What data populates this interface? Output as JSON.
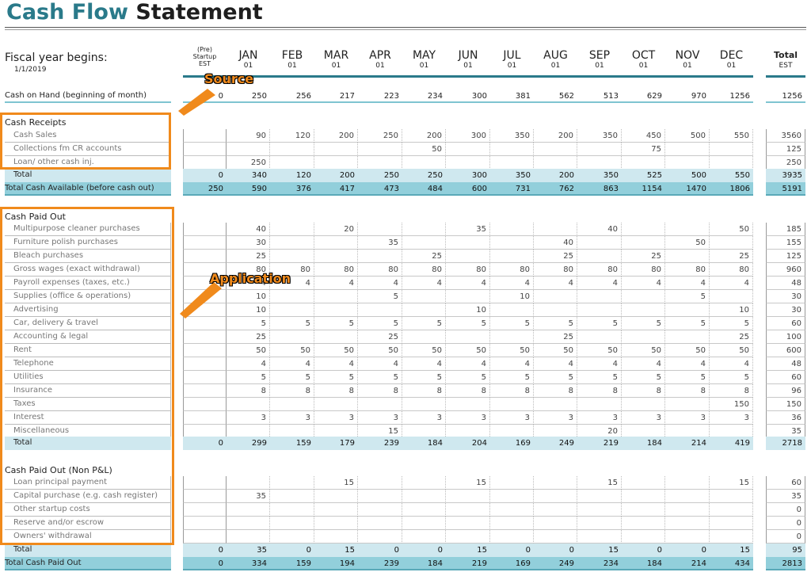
{
  "title": {
    "part1": "Cash Flow",
    "part2": "Statement"
  },
  "fiscal_label": "Fiscal year begins:",
  "fiscal_date": "1/1/2019",
  "columns": [
    {
      "pre": [
        "(Pre)",
        "Startup",
        "EST"
      ]
    },
    {
      "m": "JAN",
      "d": "01"
    },
    {
      "m": "FEB",
      "d": "01"
    },
    {
      "m": "MAR",
      "d": "01"
    },
    {
      "m": "APR",
      "d": "01"
    },
    {
      "m": "MAY",
      "d": "01"
    },
    {
      "m": "JUN",
      "d": "01"
    },
    {
      "m": "JUL",
      "d": "01"
    },
    {
      "m": "AUG",
      "d": "01"
    },
    {
      "m": "SEP",
      "d": "01"
    },
    {
      "m": "OCT",
      "d": "01"
    },
    {
      "m": "NOV",
      "d": "01"
    },
    {
      "m": "DEC",
      "d": "01"
    },
    {
      "m": "Total",
      "d": "EST"
    }
  ],
  "cash_on_hand": {
    "label": "Cash on Hand (beginning of month)",
    "values": [
      "0",
      "250",
      "256",
      "217",
      "223",
      "234",
      "300",
      "381",
      "562",
      "513",
      "629",
      "970",
      "1256",
      "1256"
    ]
  },
  "cash_receipts": {
    "header": "Cash Receipts",
    "rows": [
      {
        "label": "Cash Sales",
        "values": [
          "",
          "90",
          "120",
          "200",
          "250",
          "200",
          "300",
          "350",
          "200",
          "350",
          "450",
          "500",
          "550",
          "3560"
        ]
      },
      {
        "label": "Collections fm CR accounts",
        "values": [
          "",
          "",
          "",
          "",
          "",
          "50",
          "",
          "",
          "",
          "",
          "75",
          "",
          "",
          "125"
        ]
      },
      {
        "label": "Loan/ other cash inj.",
        "values": [
          "",
          "250",
          "",
          "",
          "",
          "",
          "",
          "",
          "",
          "",
          "",
          "",
          "",
          "250"
        ]
      }
    ],
    "total": {
      "label": "Total",
      "values": [
        "0",
        "340",
        "120",
        "200",
        "250",
        "250",
        "300",
        "350",
        "200",
        "350",
        "525",
        "500",
        "550",
        "3935"
      ]
    },
    "available": {
      "label": "Total Cash Available (before cash out)",
      "values": [
        "250",
        "590",
        "376",
        "417",
        "473",
        "484",
        "600",
        "731",
        "762",
        "863",
        "1154",
        "1470",
        "1806",
        "5191"
      ]
    }
  },
  "cash_paid_out": {
    "header": "Cash Paid Out",
    "rows": [
      {
        "label": "Multipurpose cleaner purchases",
        "values": [
          "",
          "40",
          "",
          "20",
          "",
          "",
          "35",
          "",
          "",
          "40",
          "",
          "",
          "50",
          "185"
        ]
      },
      {
        "label": "Furniture polish purchases",
        "values": [
          "",
          "30",
          "",
          "",
          "35",
          "",
          "",
          "",
          "40",
          "",
          "",
          "50",
          "",
          "155"
        ]
      },
      {
        "label": "Bleach purchases",
        "values": [
          "",
          "25",
          "",
          "",
          "",
          "25",
          "",
          "",
          "25",
          "",
          "25",
          "",
          "25",
          "125"
        ]
      },
      {
        "label": "Gross wages (exact withdrawal)",
        "values": [
          "",
          "80",
          "80",
          "80",
          "80",
          "80",
          "80",
          "80",
          "80",
          "80",
          "80",
          "80",
          "80",
          "960"
        ]
      },
      {
        "label": "Payroll expenses (taxes, etc.)",
        "values": [
          "",
          "4",
          "4",
          "4",
          "4",
          "4",
          "4",
          "4",
          "4",
          "4",
          "4",
          "4",
          "4",
          "48"
        ]
      },
      {
        "label": "Supplies (office & operations)",
        "values": [
          "",
          "10",
          "",
          "",
          "5",
          "",
          "",
          "10",
          "",
          "",
          "",
          "5",
          "",
          "30"
        ]
      },
      {
        "label": "Advertising",
        "values": [
          "",
          "10",
          "",
          "",
          "",
          "",
          "10",
          "",
          "",
          "",
          "",
          "",
          "10",
          "30"
        ]
      },
      {
        "label": "Car, delivery & travel",
        "values": [
          "",
          "5",
          "5",
          "5",
          "5",
          "5",
          "5",
          "5",
          "5",
          "5",
          "5",
          "5",
          "5",
          "60"
        ]
      },
      {
        "label": "Accounting & legal",
        "values": [
          "",
          "25",
          "",
          "",
          "25",
          "",
          "",
          "",
          "25",
          "",
          "",
          "",
          "25",
          "100"
        ]
      },
      {
        "label": "Rent",
        "values": [
          "",
          "50",
          "50",
          "50",
          "50",
          "50",
          "50",
          "50",
          "50",
          "50",
          "50",
          "50",
          "50",
          "600"
        ]
      },
      {
        "label": "Telephone",
        "values": [
          "",
          "4",
          "4",
          "4",
          "4",
          "4",
          "4",
          "4",
          "4",
          "4",
          "4",
          "4",
          "4",
          "48"
        ]
      },
      {
        "label": "Utilities",
        "values": [
          "",
          "5",
          "5",
          "5",
          "5",
          "5",
          "5",
          "5",
          "5",
          "5",
          "5",
          "5",
          "5",
          "60"
        ]
      },
      {
        "label": "Insurance",
        "values": [
          "",
          "8",
          "8",
          "8",
          "8",
          "8",
          "8",
          "8",
          "8",
          "8",
          "8",
          "8",
          "8",
          "96"
        ]
      },
      {
        "label": "Taxes",
        "values": [
          "",
          "",
          "",
          "",
          "",
          "",
          "",
          "",
          "",
          "",
          "",
          "",
          "150",
          "150"
        ]
      },
      {
        "label": "Interest",
        "values": [
          "",
          "3",
          "3",
          "3",
          "3",
          "3",
          "3",
          "3",
          "3",
          "3",
          "3",
          "3",
          "3",
          "36"
        ]
      },
      {
        "label": "Miscellaneous",
        "values": [
          "",
          "",
          "",
          "",
          "15",
          "",
          "",
          "",
          "",
          "20",
          "",
          "",
          "",
          "35"
        ]
      }
    ],
    "total": {
      "label": "Total",
      "values": [
        "0",
        "299",
        "159",
        "179",
        "239",
        "184",
        "204",
        "169",
        "249",
        "219",
        "184",
        "214",
        "419",
        "2718"
      ]
    }
  },
  "cash_paid_out_non_pl": {
    "header": "Cash Paid Out (Non P&L)",
    "rows": [
      {
        "label": "Loan principal payment",
        "values": [
          "",
          "",
          "",
          "15",
          "",
          "",
          "15",
          "",
          "",
          "15",
          "",
          "",
          "15",
          "60"
        ]
      },
      {
        "label": "Capital purchase (e.g. cash register)",
        "values": [
          "",
          "35",
          "",
          "",
          "",
          "",
          "",
          "",
          "",
          "",
          "",
          "",
          "",
          "35"
        ]
      },
      {
        "label": "Other startup costs",
        "values": [
          "",
          "",
          "",
          "",
          "",
          "",
          "",
          "",
          "",
          "",
          "",
          "",
          "",
          "0"
        ]
      },
      {
        "label": "Reserve and/or escrow",
        "values": [
          "",
          "",
          "",
          "",
          "",
          "",
          "",
          "",
          "",
          "",
          "",
          "",
          "",
          "0"
        ]
      },
      {
        "label": "Owners' withdrawal",
        "values": [
          "",
          "",
          "",
          "",
          "",
          "",
          "",
          "",
          "",
          "",
          "",
          "",
          "",
          "0"
        ]
      }
    ],
    "total": {
      "label": "Total",
      "values": [
        "0",
        "35",
        "0",
        "15",
        "0",
        "0",
        "15",
        "0",
        "0",
        "15",
        "0",
        "0",
        "15",
        "95"
      ]
    },
    "grand_total": {
      "label": "Total Cash Paid Out",
      "values": [
        "0",
        "334",
        "159",
        "194",
        "239",
        "184",
        "219",
        "169",
        "249",
        "234",
        "184",
        "214",
        "434",
        "2813"
      ]
    }
  },
  "annotations": {
    "source": "Source",
    "application": "Application"
  },
  "colors": {
    "accent": "#2a7a8a",
    "callout": "#f08a1c",
    "total_fill": "#cfe8ef",
    "grand_fill": "#92cfdb"
  }
}
